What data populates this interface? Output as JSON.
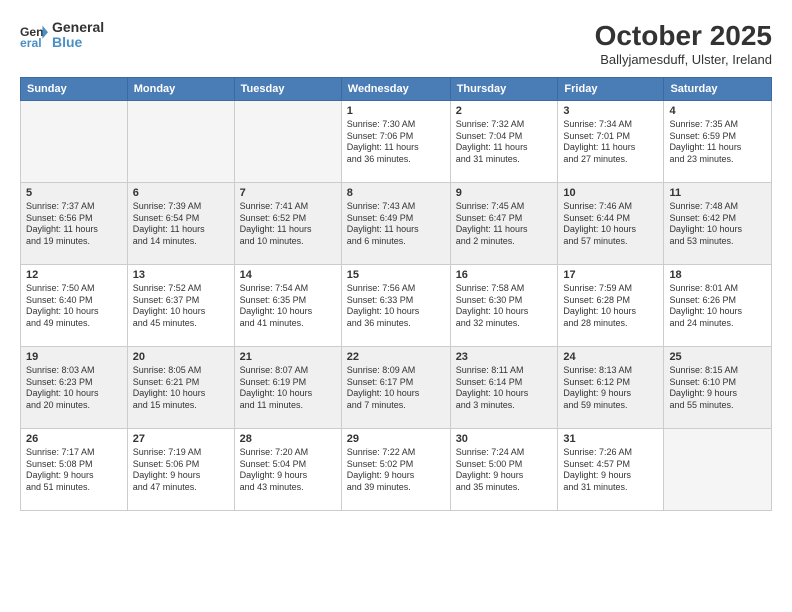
{
  "logo": {
    "line1": "General",
    "line2": "Blue"
  },
  "title": "October 2025",
  "subtitle": "Ballyjamesduff, Ulster, Ireland",
  "days_of_week": [
    "Sunday",
    "Monday",
    "Tuesday",
    "Wednesday",
    "Thursday",
    "Friday",
    "Saturday"
  ],
  "weeks": [
    [
      {
        "day": "",
        "info": "",
        "empty": true
      },
      {
        "day": "",
        "info": "",
        "empty": true
      },
      {
        "day": "",
        "info": "",
        "empty": true
      },
      {
        "day": "1",
        "info": "Sunrise: 7:30 AM\nSunset: 7:06 PM\nDaylight: 11 hours\nand 36 minutes."
      },
      {
        "day": "2",
        "info": "Sunrise: 7:32 AM\nSunset: 7:04 PM\nDaylight: 11 hours\nand 31 minutes."
      },
      {
        "day": "3",
        "info": "Sunrise: 7:34 AM\nSunset: 7:01 PM\nDaylight: 11 hours\nand 27 minutes."
      },
      {
        "day": "4",
        "info": "Sunrise: 7:35 AM\nSunset: 6:59 PM\nDaylight: 11 hours\nand 23 minutes."
      }
    ],
    [
      {
        "day": "5",
        "info": "Sunrise: 7:37 AM\nSunset: 6:56 PM\nDaylight: 11 hours\nand 19 minutes.",
        "shaded": true
      },
      {
        "day": "6",
        "info": "Sunrise: 7:39 AM\nSunset: 6:54 PM\nDaylight: 11 hours\nand 14 minutes.",
        "shaded": true
      },
      {
        "day": "7",
        "info": "Sunrise: 7:41 AM\nSunset: 6:52 PM\nDaylight: 11 hours\nand 10 minutes.",
        "shaded": true
      },
      {
        "day": "8",
        "info": "Sunrise: 7:43 AM\nSunset: 6:49 PM\nDaylight: 11 hours\nand 6 minutes.",
        "shaded": true
      },
      {
        "day": "9",
        "info": "Sunrise: 7:45 AM\nSunset: 6:47 PM\nDaylight: 11 hours\nand 2 minutes.",
        "shaded": true
      },
      {
        "day": "10",
        "info": "Sunrise: 7:46 AM\nSunset: 6:44 PM\nDaylight: 10 hours\nand 57 minutes.",
        "shaded": true
      },
      {
        "day": "11",
        "info": "Sunrise: 7:48 AM\nSunset: 6:42 PM\nDaylight: 10 hours\nand 53 minutes.",
        "shaded": true
      }
    ],
    [
      {
        "day": "12",
        "info": "Sunrise: 7:50 AM\nSunset: 6:40 PM\nDaylight: 10 hours\nand 49 minutes."
      },
      {
        "day": "13",
        "info": "Sunrise: 7:52 AM\nSunset: 6:37 PM\nDaylight: 10 hours\nand 45 minutes."
      },
      {
        "day": "14",
        "info": "Sunrise: 7:54 AM\nSunset: 6:35 PM\nDaylight: 10 hours\nand 41 minutes."
      },
      {
        "day": "15",
        "info": "Sunrise: 7:56 AM\nSunset: 6:33 PM\nDaylight: 10 hours\nand 36 minutes."
      },
      {
        "day": "16",
        "info": "Sunrise: 7:58 AM\nSunset: 6:30 PM\nDaylight: 10 hours\nand 32 minutes."
      },
      {
        "day": "17",
        "info": "Sunrise: 7:59 AM\nSunset: 6:28 PM\nDaylight: 10 hours\nand 28 minutes."
      },
      {
        "day": "18",
        "info": "Sunrise: 8:01 AM\nSunset: 6:26 PM\nDaylight: 10 hours\nand 24 minutes."
      }
    ],
    [
      {
        "day": "19",
        "info": "Sunrise: 8:03 AM\nSunset: 6:23 PM\nDaylight: 10 hours\nand 20 minutes.",
        "shaded": true
      },
      {
        "day": "20",
        "info": "Sunrise: 8:05 AM\nSunset: 6:21 PM\nDaylight: 10 hours\nand 15 minutes.",
        "shaded": true
      },
      {
        "day": "21",
        "info": "Sunrise: 8:07 AM\nSunset: 6:19 PM\nDaylight: 10 hours\nand 11 minutes.",
        "shaded": true
      },
      {
        "day": "22",
        "info": "Sunrise: 8:09 AM\nSunset: 6:17 PM\nDaylight: 10 hours\nand 7 minutes.",
        "shaded": true
      },
      {
        "day": "23",
        "info": "Sunrise: 8:11 AM\nSunset: 6:14 PM\nDaylight: 10 hours\nand 3 minutes.",
        "shaded": true
      },
      {
        "day": "24",
        "info": "Sunrise: 8:13 AM\nSunset: 6:12 PM\nDaylight: 9 hours\nand 59 minutes.",
        "shaded": true
      },
      {
        "day": "25",
        "info": "Sunrise: 8:15 AM\nSunset: 6:10 PM\nDaylight: 9 hours\nand 55 minutes.",
        "shaded": true
      }
    ],
    [
      {
        "day": "26",
        "info": "Sunrise: 7:17 AM\nSunset: 5:08 PM\nDaylight: 9 hours\nand 51 minutes."
      },
      {
        "day": "27",
        "info": "Sunrise: 7:19 AM\nSunset: 5:06 PM\nDaylight: 9 hours\nand 47 minutes."
      },
      {
        "day": "28",
        "info": "Sunrise: 7:20 AM\nSunset: 5:04 PM\nDaylight: 9 hours\nand 43 minutes."
      },
      {
        "day": "29",
        "info": "Sunrise: 7:22 AM\nSunset: 5:02 PM\nDaylight: 9 hours\nand 39 minutes."
      },
      {
        "day": "30",
        "info": "Sunrise: 7:24 AM\nSunset: 5:00 PM\nDaylight: 9 hours\nand 35 minutes."
      },
      {
        "day": "31",
        "info": "Sunrise: 7:26 AM\nSunset: 4:57 PM\nDaylight: 9 hours\nand 31 minutes."
      },
      {
        "day": "",
        "info": "",
        "empty": true
      }
    ]
  ]
}
